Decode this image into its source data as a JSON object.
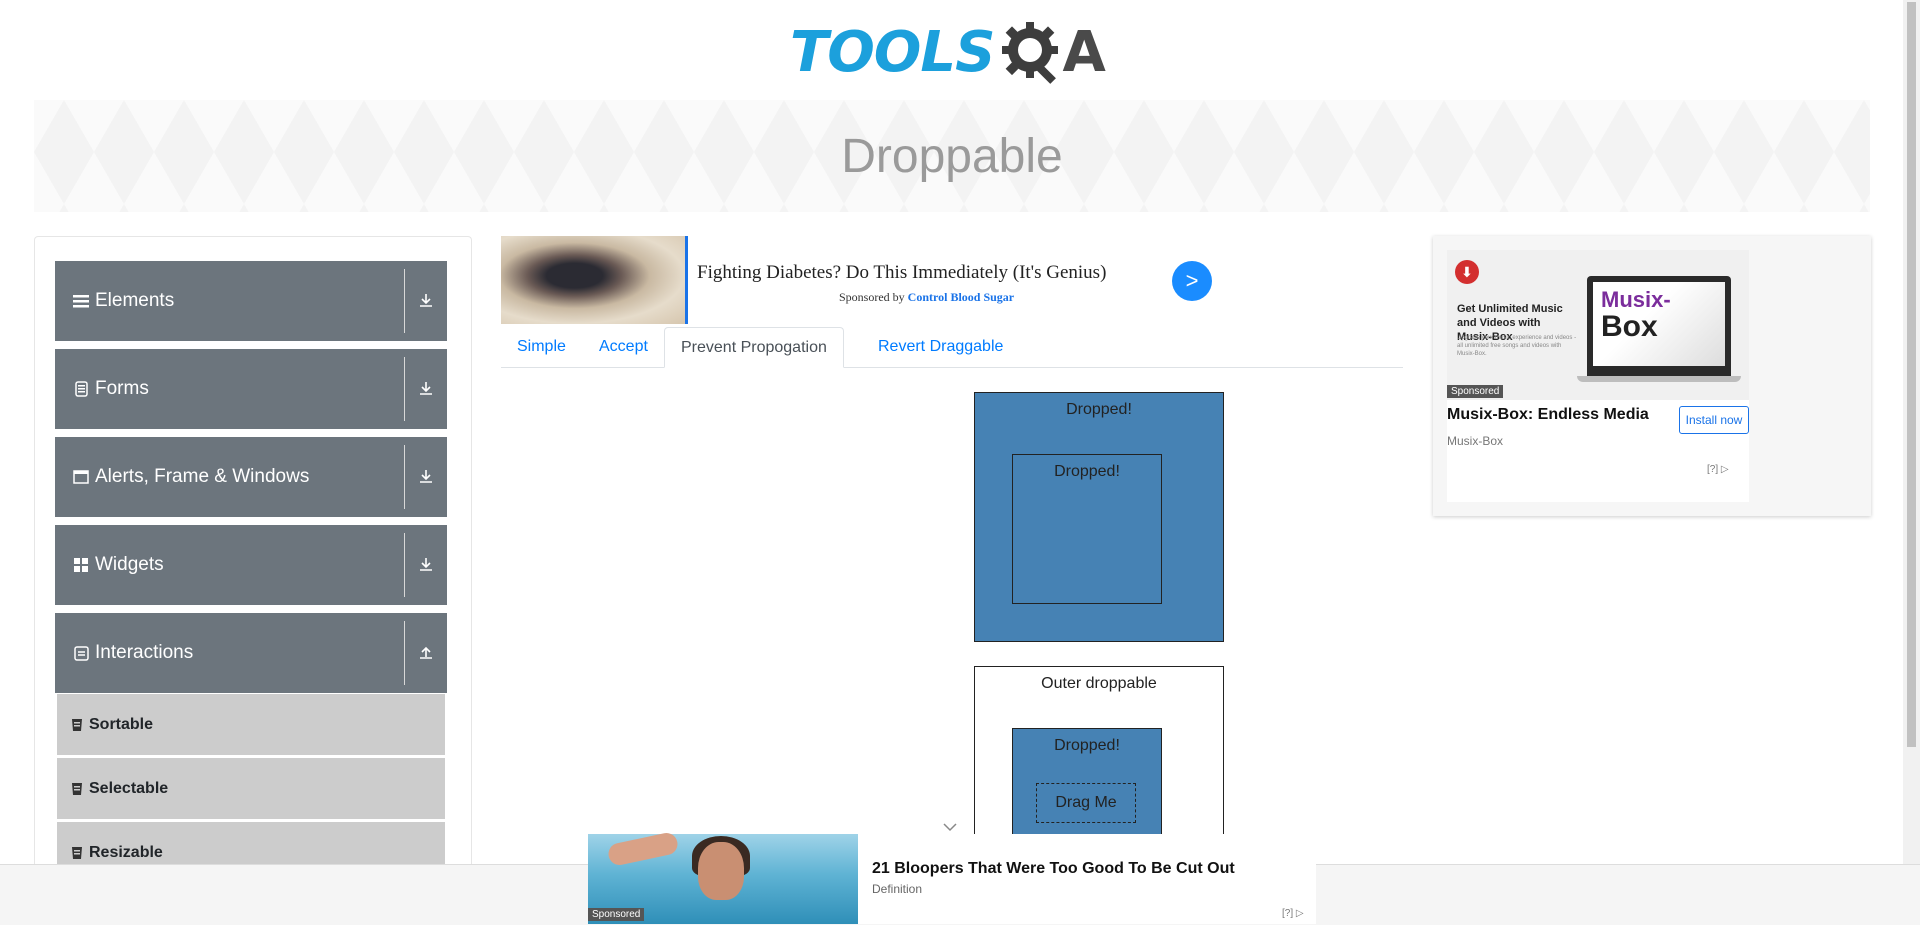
{
  "header": {
    "logo_text_a": "TOOLS",
    "logo_text_b": "A"
  },
  "page": {
    "title": "Droppable"
  },
  "sidebar": {
    "groups": [
      {
        "label": "Elements",
        "icon": "menu-icon",
        "arrow": "download-icon"
      },
      {
        "label": "Forms",
        "icon": "form-icon",
        "arrow": "download-icon"
      },
      {
        "label": "Alerts, Frame & Windows",
        "icon": "window-icon",
        "arrow": "download-icon"
      },
      {
        "label": "Widgets",
        "icon": "widgets-icon",
        "arrow": "download-icon"
      },
      {
        "label": "Interactions",
        "icon": "interactions-icon",
        "arrow": "upload-icon"
      }
    ],
    "items": [
      {
        "label": "Sortable"
      },
      {
        "label": "Selectable"
      },
      {
        "label": "Resizable"
      }
    ]
  },
  "top_ad": {
    "headline": "Fighting Diabetes? Do This Immediately (It's Genius)",
    "sponsored_by": "Sponsored by",
    "sponsor": "Control Blood Sugar",
    "go": ">"
  },
  "tabs": [
    {
      "label": "Simple",
      "active": false
    },
    {
      "label": "Accept",
      "active": false
    },
    {
      "label": "Prevent Propogation",
      "active": true
    },
    {
      "label": "Revert Draggable",
      "active": false
    }
  ],
  "droppable": {
    "greedy_outer_text": "Dropped!",
    "greedy_inner_text": "Dropped!",
    "outer_text": "Outer droppable",
    "inner_text": "Dropped!",
    "drag_text": "Drag Me"
  },
  "right_ad": {
    "pic_headline": "Get Unlimited Music and Videos with Musix-Box",
    "pic_small": "Upgrade your music experience and videos - all unlimited free songs and videos with Musix-Box.",
    "brand_line1": "Musix-",
    "brand_line2": "Box",
    "sponsored": "Sponsored",
    "title": "Musix-Box: Endless Media",
    "source": "Musix-Box",
    "install": "Install now",
    "adchoice": "[?]"
  },
  "bottom_ad": {
    "headline": "21 Bloopers That Were Too Good To Be Cut Out",
    "source": "Definition",
    "sponsored": "Sponsored",
    "adchoice": "[?]"
  },
  "colors": {
    "accent": "#007bff",
    "sidebar_group": "#6c757d",
    "sidebar_item": "#cccccc",
    "dropped": "#4682b4",
    "logo_blue": "#1ca0dc"
  }
}
